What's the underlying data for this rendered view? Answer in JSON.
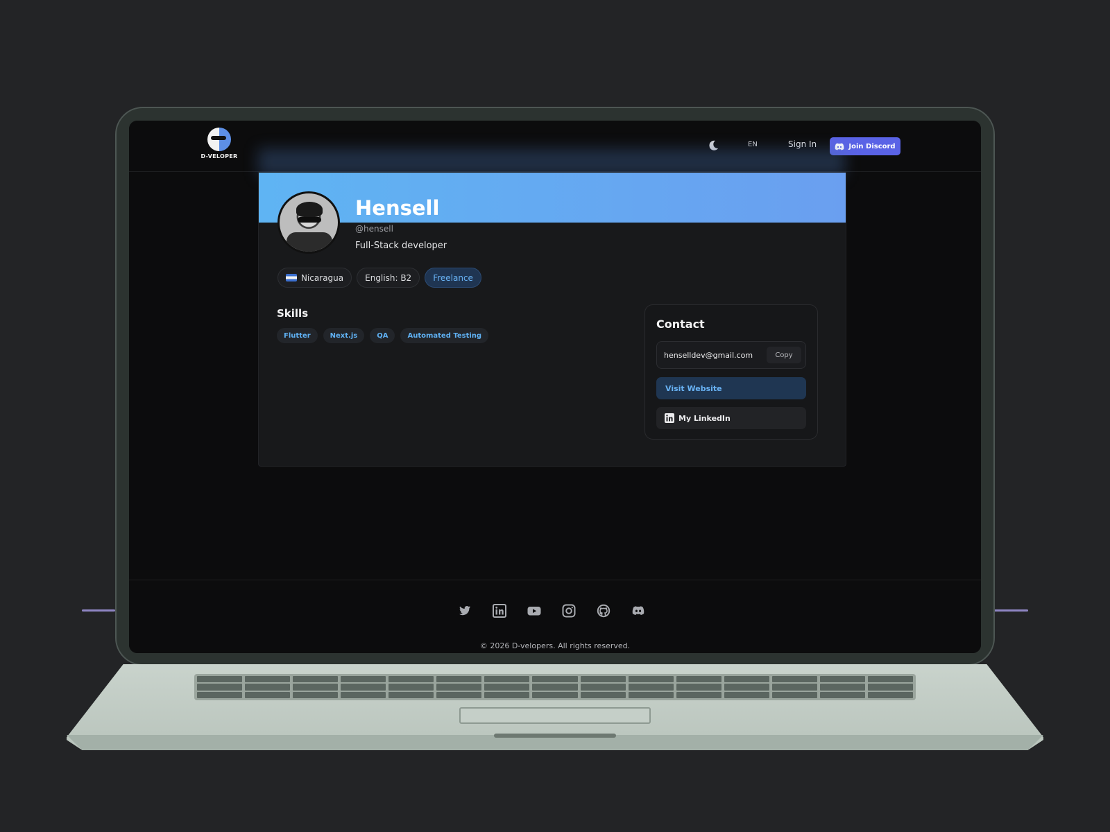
{
  "navbar": {
    "logo_text": "D-VELOPER",
    "language": "EN",
    "sign_in": "Sign In",
    "join_discord": "Join Discord"
  },
  "profile": {
    "name": "Hensell",
    "handle": "@hensell",
    "role": "Full-Stack developer",
    "tags": [
      "Nicaragua",
      "English: B2",
      "Freelance"
    ]
  },
  "skills": {
    "title": "Skills",
    "items": [
      "Flutter",
      "Next.js",
      "QA",
      "Automated Testing"
    ]
  },
  "contact": {
    "title": "Contact",
    "email": "henselldev@gmail.com",
    "copy": "Copy",
    "visit_website": "Visit Website",
    "linkedin": "My LinkedIn"
  },
  "footer": {
    "social_icons": [
      "twitter-icon",
      "linkedin-icon",
      "youtube-icon",
      "instagram-icon",
      "github-icon",
      "discord-icon"
    ],
    "copyright": "© 2026 D-velopers. All rights reserved."
  },
  "colors": {
    "accent_blue": "#69b3f5",
    "discord": "#5a63e6",
    "banner_start": "#5fb4f3",
    "banner_end": "#6a9ff0",
    "background": "#0c0c0d"
  }
}
